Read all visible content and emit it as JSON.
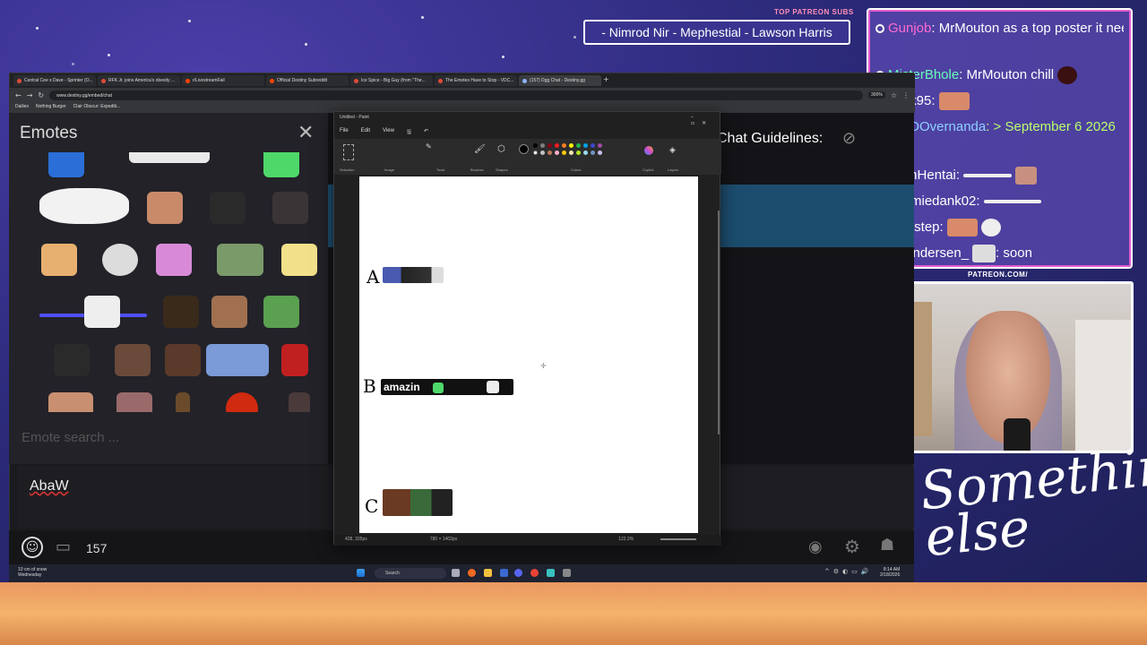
{
  "overlay": {
    "patreon_label": "TOP PATREON SUBS",
    "patreon_names": "- Nimrod Nir - Mephestial - Lawson Harris",
    "patreon_tag": "PATREON.COM/",
    "brand_text": "Something else",
    "chat": [
      {
        "user": "Gunjob",
        "user_color": "#ff6bd0",
        "message": ": MrMouton as a top poster it needs more recognition"
      },
      {
        "user": "MisterBhole",
        "user_color": "#66ffb8",
        "message": ": MrMouton chill"
      },
      {
        "user": "Jorik95",
        "user_color": "#ffffff",
        "message": ":"
      },
      {
        "user": "OOOOvernanda",
        "user_color": "#8fd0ff",
        "message": ": > September 6 2026",
        "message_color": "#b8ff6b"
      },
      {
        "user": "JohnHentai",
        "user_color": "#ffffff",
        "message": ":"
      },
      {
        "user": "temmiedank02",
        "user_color": "#ffffff",
        "message": ":"
      },
      {
        "user": "Wildstep",
        "user_color": "#ffffff",
        "message": ":"
      },
      {
        "user": "MrAndersen_",
        "user_color": "#ffffff",
        "message": ": soon"
      }
    ]
  },
  "browser": {
    "tabs": [
      "Central Cee x Dave - Sprinter (O...",
      "RFK Jr. joins America's obesity ...",
      "r/LivestreamFail",
      "Official Destiny Subreddit",
      "Ice Spice - Big Guy (from \"The...",
      "The Emotes Have to Stop - VDC...",
      "(157) Dgg Chat - Destiny.gg"
    ],
    "url": "www.destiny.gg/embed/chat",
    "zoom": "300%",
    "bookmarks": [
      "Dailies",
      "Nothing Burger",
      "Clair Obscur: Expediti..."
    ]
  },
  "emotes_panel": {
    "title": "Emotes",
    "search_placeholder": "Emote search ..."
  },
  "chat": {
    "guidelines": "Chat Guidelines:",
    "input_text": "AbaW",
    "user_count": "157"
  },
  "paint": {
    "window_title": "Untitled - Paint",
    "menu": [
      "File",
      "Edit",
      "View"
    ],
    "ribbon_groups": [
      "Selection",
      "Image",
      "Tools",
      "Brushes",
      "Shapes",
      "Colors",
      "Copilot",
      "Layers"
    ],
    "canvas_letters": [
      "A",
      "B",
      "C"
    ],
    "b_strip_text": "amazin",
    "status_pos": "428, 335px",
    "status_size": "780 × 1402px",
    "status_zoom": "122.3%"
  },
  "taskbar": {
    "weather_temp": "10 cm of snow",
    "weather_day": "Wednesday",
    "search": "Search",
    "time": "8:14 AM",
    "date": "2/18/2026"
  },
  "colors": {
    "overlay_border": "#ffffff",
    "overlay_pink": "#e25ccf",
    "bg_purple": "#2c2a7a"
  }
}
